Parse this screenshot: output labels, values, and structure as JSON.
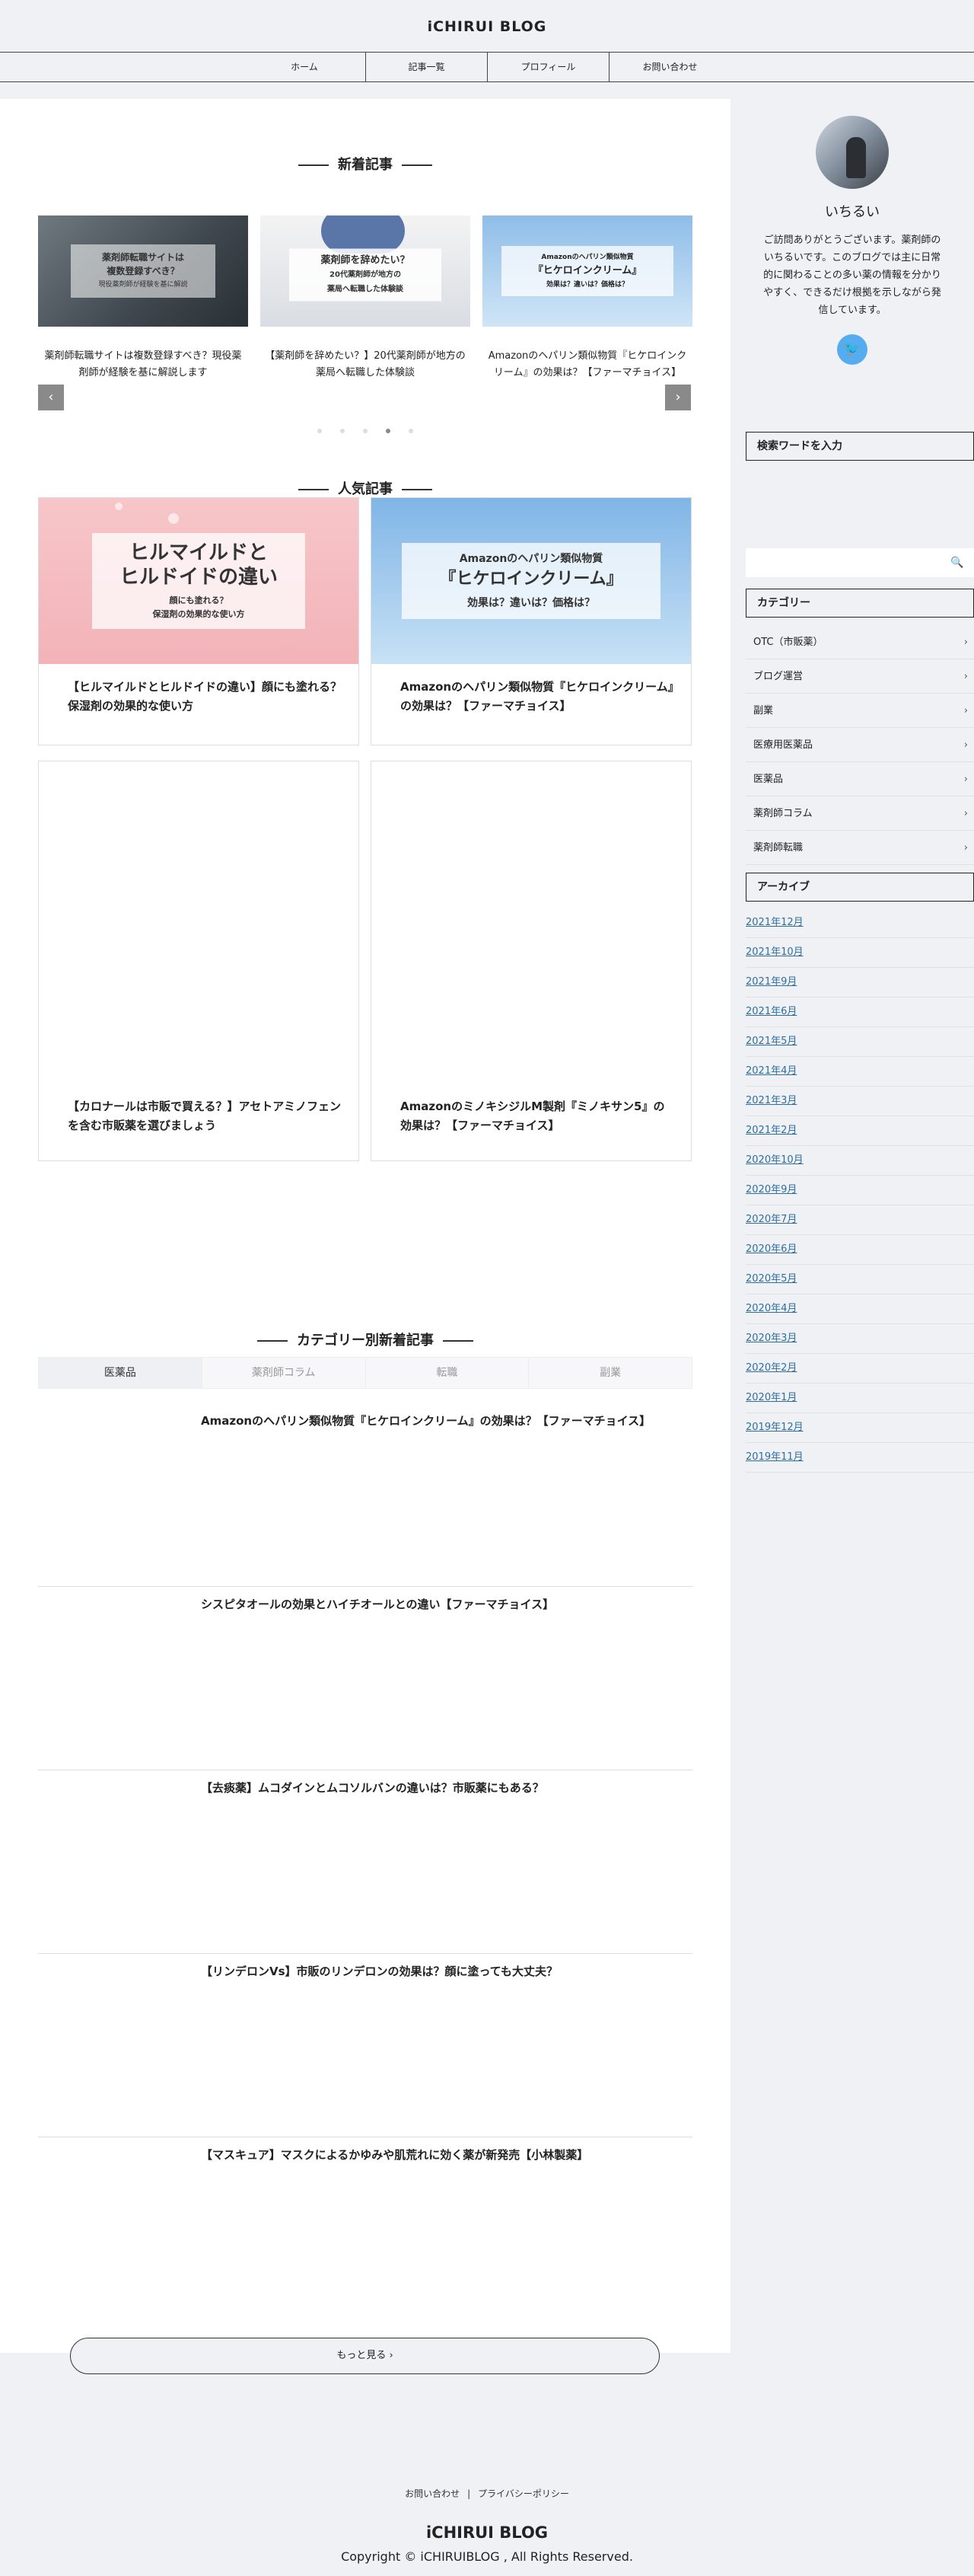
{
  "site": {
    "title": "iCHIRUI BLOG"
  },
  "nav": [
    "ホーム",
    "記事一覧",
    "プロフィール",
    "お問い合わせ"
  ],
  "latest": {
    "title": "新着記事",
    "slides": [
      {
        "thumb_lines": [
          "薬剤師転職サイトは",
          "複数登録すべき？",
          "現役薬剤師が経験を基に解説"
        ],
        "caption": "薬剤師転職サイトは複数登録すべき？現役薬剤師が経験を基に解説します"
      },
      {
        "thumb_lines": [
          "薬剤師を辞めたい？",
          "20代薬剤師が地方の",
          "薬局へ転職した体験談"
        ],
        "caption": "【薬剤師を辞めたい？】20代薬剤師が地方の薬局へ転職した体験談"
      },
      {
        "thumb_lines": [
          "Amazonのヘパリン類似物質",
          "『ヒケロインクリーム』",
          "効果は？違いは？価格は？"
        ],
        "caption": "Amazonのヘパリン類似物質『ヒケロインクリーム』の効果は？【ファーマチョイス】"
      }
    ],
    "prev_icon": "chevron-left-icon",
    "next_icon": "chevron-right-icon"
  },
  "popular": {
    "title": "人気記事",
    "cards": [
      {
        "img_lines": [
          "ヒルマイルドと",
          "ヒルドイドの違い",
          "顔にも塗れる？",
          "保湿剤の効果的な使い方"
        ],
        "title": "【ヒルマイルドとヒルドイドの違い】顔にも塗れる？保湿剤の効果的な使い方"
      },
      {
        "img_lines": [
          "Amazonのヘパリン類似物質",
          "『ヒケロインクリーム』",
          "効果は？違いは？価格は？"
        ],
        "title": "Amazonのヘパリン類似物質『ヒケロインクリーム』の効果は？【ファーマチョイス】"
      },
      {
        "img_lines": [],
        "title": "【カロナールは市販で買える？】アセトアミノフェンを含む市販薬を選びましょう"
      },
      {
        "img_lines": [],
        "title": "AmazonのミノキシジルM製剤『ミノキサン5』の効果は？【ファーマチョイス】"
      }
    ]
  },
  "category_latest": {
    "title": "カテゴリー別新着記事",
    "tabs": [
      "医薬品",
      "薬剤師コラム",
      "転職",
      "副業"
    ],
    "items": [
      "Amazonのヘパリン類似物質『ヒケロインクリーム』の効果は？【ファーマチョイス】",
      "シスピタオールの効果とハイチオールとの違い【ファーマチョイス】",
      "【去痰薬】ムコダインとムコソルバンの違いは？市販薬にもある？",
      "【リンデロンVs】市販のリンデロンの効果は？顔に塗っても大丈夫？",
      "【マスキュア】マスクによるかゆみや肌荒れに効く薬が新発売【小林製薬】"
    ],
    "more_label": "もっと見る ›"
  },
  "profile": {
    "name": "いちるい",
    "desc": "ご訪問ありがとうございます。薬剤師のいちるいです。このブログでは主に日常的に関わることの多い薬の情報を分かりやすく、できるだけ根拠を示しながら発信しています。",
    "twitter_icon": "twitter-icon"
  },
  "search": {
    "title": "検索ワードを入力",
    "placeholder": ""
  },
  "categories": {
    "title": "カテゴリー",
    "items": [
      "OTC（市販薬）",
      "ブログ運営",
      "副業",
      "医療用医薬品",
      "医薬品",
      "薬剤師コラム",
      "薬剤師転職"
    ]
  },
  "archive": {
    "title": "アーカイブ",
    "items": [
      "2021年12月",
      "2021年10月",
      "2021年9月",
      "2021年6月",
      "2021年5月",
      "2021年4月",
      "2021年3月",
      "2021年2月",
      "2020年10月",
      "2020年9月",
      "2020年7月",
      "2020年6月",
      "2020年5月",
      "2020年4月",
      "2020年3月",
      "2020年2月",
      "2020年1月",
      "2019年12月",
      "2019年11月"
    ]
  },
  "footer": {
    "links": [
      "お問い合わせ",
      "プライバシーポリシー"
    ],
    "separator": "|",
    "title": "iCHIRUI BLOG",
    "copyright": "Copyright © iCHIRUIBLOG , All Rights Reserved."
  },
  "colors": {
    "accent_twitter": "#55acee",
    "link": "#2c6ea0",
    "bg": "#f0f1f5"
  }
}
